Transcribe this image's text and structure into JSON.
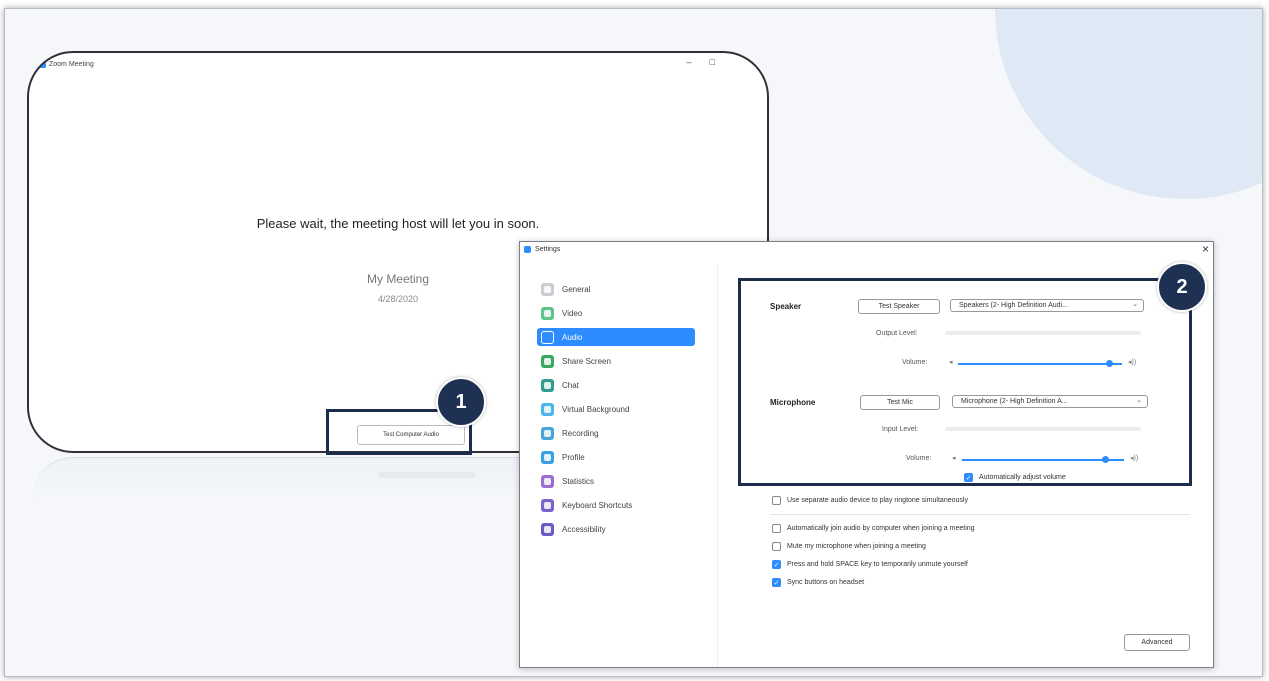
{
  "zoom_window": {
    "title": "Zoom Meeting",
    "minimize": "–",
    "maximize": "□",
    "wait_message": "Please wait, the meeting host will let you in soon.",
    "meeting_name": "My Meeting",
    "meeting_date": "4/28/2020",
    "test_audio_button": "Test Computer Audio"
  },
  "badges": {
    "one": "1",
    "two": "2"
  },
  "settings": {
    "title": "Settings",
    "close": "×",
    "nav": [
      {
        "label": "General",
        "color": "#c9ccd1"
      },
      {
        "label": "Video",
        "color": "#5fc28a"
      },
      {
        "label": "Audio",
        "color": "#2d8cff",
        "active": true
      },
      {
        "label": "Share Screen",
        "color": "#3aa860"
      },
      {
        "label": "Chat",
        "color": "#2f9e8e"
      },
      {
        "label": "Virtual Background",
        "color": "#4db6e8"
      },
      {
        "label": "Recording",
        "color": "#46a6d8"
      },
      {
        "label": "Profile",
        "color": "#3aa0e6"
      },
      {
        "label": "Statistics",
        "color": "#9b6fd0"
      },
      {
        "label": "Keyboard Shortcuts",
        "color": "#7a62c9"
      },
      {
        "label": "Accessibility",
        "color": "#6e58c2"
      }
    ],
    "speaker": {
      "label": "Speaker",
      "test_button": "Test Speaker",
      "device": "Speakers (2- High Definition Audi...",
      "output_level_label": "Output Level:",
      "volume_label": "Volume:",
      "volume": 0.92
    },
    "microphone": {
      "label": "Microphone",
      "test_button": "Test Mic",
      "device": "Microphone (2- High Definition A...",
      "input_level_label": "Input Level:",
      "volume_label": "Volume:",
      "volume": 0.88,
      "auto_adjust": "Automatically adjust volume"
    },
    "options": [
      {
        "label": "Use separate audio device to play ringtone simultaneously",
        "checked": false
      },
      {
        "label": "Automatically join audio by computer when joining a meeting",
        "checked": false
      },
      {
        "label": "Mute my microphone when joining a meeting",
        "checked": false
      },
      {
        "label": "Press and hold SPACE key to temporarily unmute yourself",
        "checked": true
      },
      {
        "label": "Sync buttons on headset",
        "checked": true
      }
    ],
    "advanced_button": "Advanced"
  }
}
